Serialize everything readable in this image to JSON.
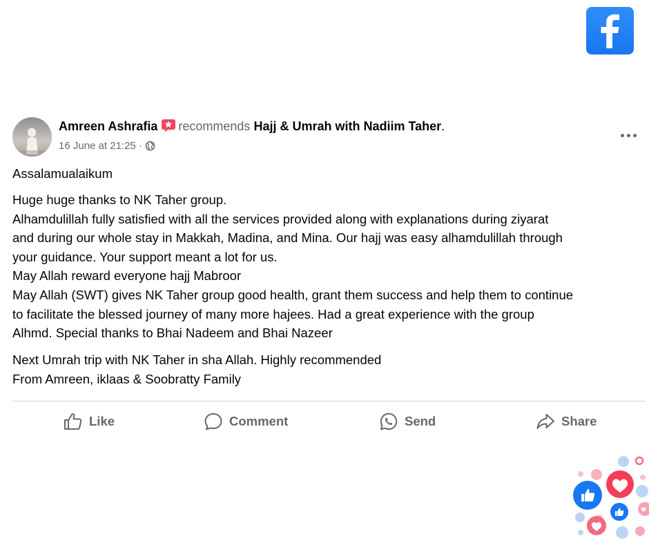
{
  "post": {
    "author": "Amreen Ashrafia",
    "action_text": "recommends",
    "page_name": "Hajj & Umrah with Nadiim Taher",
    "period": ".",
    "timestamp": "16 June at 21:25",
    "dot": "·",
    "greeting": "Assalamualaikum",
    "paragraph1": [
      "Huge huge thanks to NK Taher group.",
      "Alhamdulillah fully satisfied with all the services provided along with explanations during ziyarat",
      "and during our whole stay in Makkah, Madina, and Mina. Our hajj was easy alhamdulillah through",
      "your guidance. Your support meant a lot for us.",
      "May Allah reward everyone hajj Mabroor",
      "May Allah (SWT) gives NK Taher group good health, grant them success and help them to continue",
      "to facilitate the blessed journey of many more hajees. Had a great experience with the group",
      "Alhmd. Special thanks to Bhai Nadeem and Bhai Nazeer"
    ],
    "paragraph2": [
      "Next Umrah trip with NK Taher in sha Allah. Highly recommended",
      "From Amreen, iklaas & Soobratty Family"
    ]
  },
  "actions": {
    "like": "Like",
    "comment": "Comment",
    "send": "Send",
    "share": "Share"
  },
  "icons": {
    "brand": "facebook-logo-icon",
    "badge": "top-fan-star-badge-icon",
    "privacy": "globe-icon",
    "menu": "more-options-icon",
    "like": "thumbs-up-icon",
    "comment": "speech-bubble-icon",
    "send": "whatsapp-icon",
    "share": "share-arrow-icon",
    "decoration": "reactions-cluster-icon"
  },
  "colors": {
    "facebook_blue": "#1877f2",
    "text_primary": "#050505",
    "text_secondary": "#65676b",
    "badge_pink": "#f02849",
    "heart_red": "#f33e58"
  }
}
